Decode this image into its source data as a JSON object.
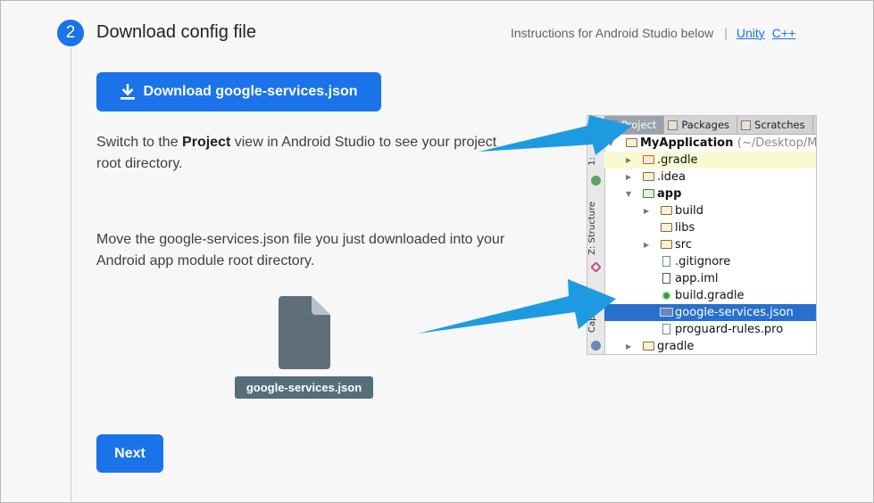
{
  "step": {
    "number": "2",
    "title": "Download config file",
    "instructions_text": "Instructions for Android Studio below",
    "separator": "|",
    "links": [
      "Unity",
      "C++"
    ]
  },
  "download_button": {
    "label": "Download google-services.json",
    "icon": "download-icon"
  },
  "para1": {
    "part1": "Switch to the ",
    "bold": "Project",
    "part2": " view in Android Studio to see your project root directory."
  },
  "para2": {
    "text": "Move the google-services.json file you just downloaded into your Android app module root directory."
  },
  "file_illustration": {
    "label": "google-services.json",
    "icon": "file-icon"
  },
  "next_button": {
    "label": "Next"
  },
  "android_studio": {
    "tabs": [
      "Project",
      "Packages",
      "Scratches"
    ],
    "side_labels": [
      "1:",
      "Z: Structure",
      "Captures"
    ],
    "tree": [
      {
        "label": "MyApplication",
        "suffix": "(~/Desktop/My"
      },
      {
        "label": ".gradle"
      },
      {
        "label": ".idea"
      },
      {
        "label": "app"
      },
      {
        "label": "build"
      },
      {
        "label": "libs"
      },
      {
        "label": "src"
      },
      {
        "label": ".gitignore"
      },
      {
        "label": "app.iml"
      },
      {
        "label": "build.gradle"
      },
      {
        "label": "google-services.json"
      },
      {
        "label": "proguard-rules.pro"
      },
      {
        "label": "gradle"
      }
    ]
  },
  "colors": {
    "primary": "#1a73e8",
    "file_label_bg": "#546e7a",
    "arrow": "#1e9be0"
  }
}
